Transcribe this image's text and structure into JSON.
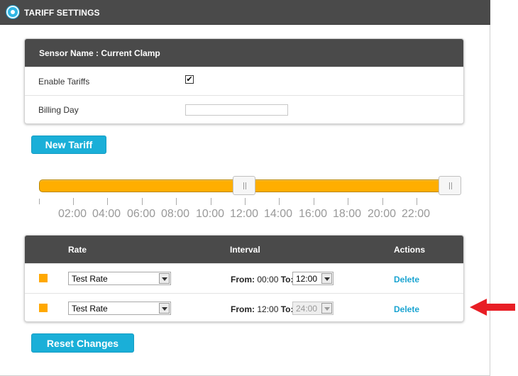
{
  "header": {
    "title": "TARIFF SETTINGS"
  },
  "sensor": {
    "title": "Sensor Name : Current Clamp",
    "enable_label": "Enable Tariffs",
    "enable_checked": "✔",
    "billing_label": "Billing Day",
    "billing_value": ""
  },
  "buttons": {
    "new_tariff": "New Tariff",
    "reset": "Reset Changes"
  },
  "slider": {
    "ticks": [
      "02:00",
      "04:00",
      "06:00",
      "08:00",
      "10:00",
      "12:00",
      "14:00",
      "16:00",
      "18:00",
      "20:00",
      "22:00"
    ],
    "handles": [
      "12:00",
      "24:00"
    ]
  },
  "rates": {
    "headers": {
      "rate": "Rate",
      "interval": "Interval",
      "actions": "Actions"
    },
    "rows": [
      {
        "rate": "Test Rate",
        "from_label": "From:",
        "from": "00:00",
        "to_label": "To:",
        "to": "12:00",
        "to_disabled": false,
        "action": "Delete",
        "color": "#ffa800"
      },
      {
        "rate": "Test Rate",
        "from_label": "From:",
        "from": "12:00",
        "to_label": "To:",
        "to": "24:00",
        "to_disabled": true,
        "action": "Delete",
        "color": "#ffa800"
      }
    ]
  },
  "colors": {
    "accent": "#1aafd8",
    "bar": "#ffae00",
    "header_bg": "#4a4a4a",
    "annotation": "#e81e25"
  },
  "icons": {
    "header": "tariff-ring-icon",
    "annotation": "red-arrow-icon"
  }
}
